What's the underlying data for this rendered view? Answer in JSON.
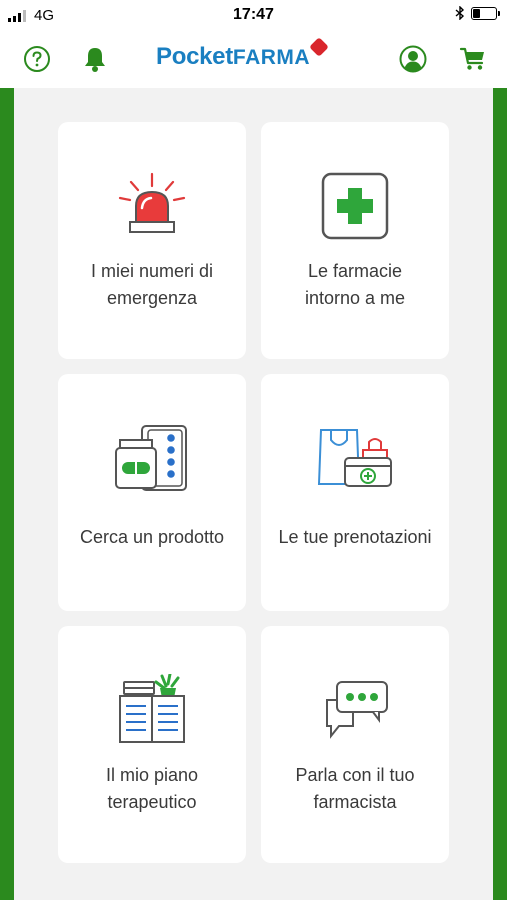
{
  "status_bar": {
    "carrier": "4G",
    "time": "17:47"
  },
  "header": {
    "logo_part1": "Pocket",
    "logo_part2": "FARMA",
    "icons": [
      "help-icon",
      "bell-icon",
      "user-icon",
      "cart-icon"
    ]
  },
  "colors": {
    "brand_green": "#2b8a1e",
    "brand_blue": "#1a7fc1",
    "accent_red": "#d9262c"
  },
  "tiles": [
    {
      "line1": "I miei numeri di",
      "line2": "emergenza",
      "icon": "siren-icon"
    },
    {
      "line1": "Le farmacie",
      "line2": "intorno a me",
      "icon": "pharmacy-cross-icon"
    },
    {
      "line1": "Cerca un prodotto",
      "icon": "medicine-products-icon"
    },
    {
      "line1": "Le tue prenotazioni",
      "icon": "shopping-bags-icon"
    },
    {
      "line1": "Il mio piano",
      "line2": "terapeutico",
      "icon": "therapy-book-plant-icon"
    },
    {
      "line1": "Parla con il tuo",
      "line2": "farmacista",
      "icon": "chat-bubbles-icon"
    }
  ]
}
